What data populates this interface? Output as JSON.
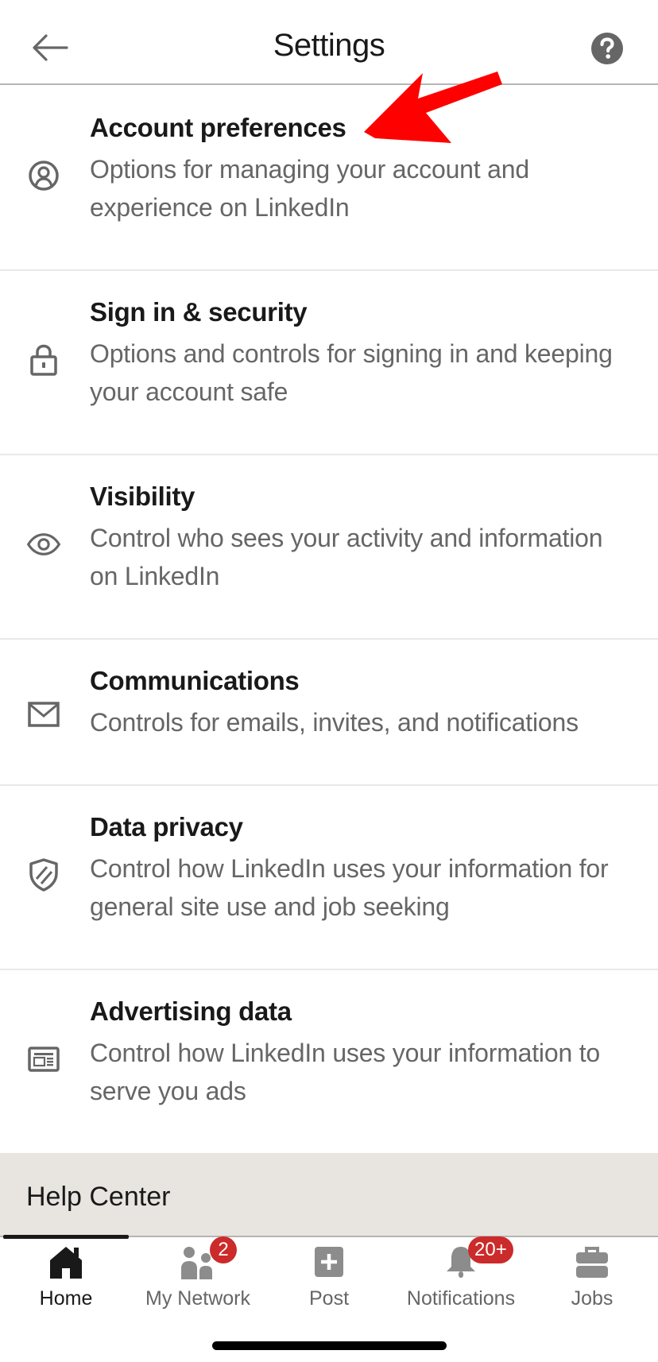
{
  "header": {
    "title": "Settings",
    "back_icon": "arrow-left-icon",
    "help_icon": "question-circle-icon"
  },
  "settings": [
    {
      "title": "Account preferences",
      "description": "Options for managing your account and experience on LinkedIn",
      "icon": "user-circle-icon"
    },
    {
      "title": "Sign in & security",
      "description": "Options and controls for signing in and keeping your account safe",
      "icon": "lock-icon"
    },
    {
      "title": "Visibility",
      "description": "Control who sees your activity and information on LinkedIn",
      "icon": "eye-icon"
    },
    {
      "title": "Communications",
      "description": "Controls for emails, invites, and notifications",
      "icon": "envelope-icon"
    },
    {
      "title": "Data privacy",
      "description": "Control how LinkedIn uses your information for general site use and job seeking",
      "icon": "shield-icon"
    },
    {
      "title": "Advertising data",
      "description": "Control how LinkedIn uses your information to serve you ads",
      "icon": "ad-card-icon"
    }
  ],
  "help_center": {
    "label": "Help Center"
  },
  "tabbar": {
    "tabs": [
      {
        "label": "Home",
        "icon": "home-icon",
        "active": true
      },
      {
        "label": "My Network",
        "icon": "people-icon",
        "badge": "2"
      },
      {
        "label": "Post",
        "icon": "plus-square-icon"
      },
      {
        "label": "Notifications",
        "icon": "bell-icon",
        "badge": "20+"
      },
      {
        "label": "Jobs",
        "icon": "briefcase-icon"
      }
    ]
  },
  "colors": {
    "badge": "#cb2b2a",
    "annotation_arrow": "#ff0000",
    "help_center_bg": "#e8e5e0"
  }
}
